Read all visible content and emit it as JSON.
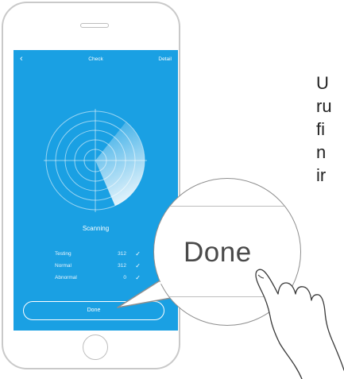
{
  "nav": {
    "back_glyph": "‹",
    "title": "Check",
    "detail_label": "Detail"
  },
  "scan": {
    "status": "Scanning",
    "stats": [
      {
        "label": "Testing",
        "value": "312"
      },
      {
        "label": "Normal",
        "value": "312"
      },
      {
        "label": "Abnormal",
        "value": "0"
      }
    ],
    "check_glyph": "✓"
  },
  "done_button_label": "Done",
  "zoom_callout_label": "Done",
  "instruction_lines": [
    "U",
    "ru",
    "fi",
    "n",
    "ir"
  ],
  "colors": {
    "screen_bg": "#1aa0e3",
    "text_dark": "#222222"
  },
  "icons": [
    "back-chevron-icon",
    "radar-icon",
    "checkmark-icon",
    "hand-pointer-icon"
  ]
}
